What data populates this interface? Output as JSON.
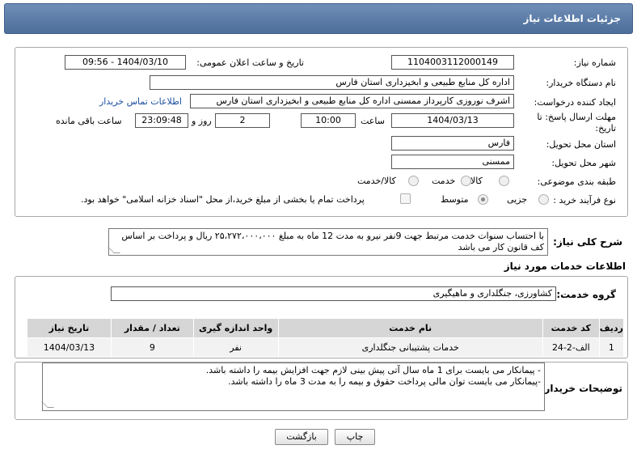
{
  "header": {
    "title": "جزئیات اطلاعات نیاز"
  },
  "form": {
    "need_number_label": "شماره نیاز:",
    "need_number": "1104003112000149",
    "announce_label": "تاریخ و ساعت اعلان عمومی:",
    "announce_value": "1404/03/10 - 09:56",
    "buyer_label": "نام دستگاه خریدار:",
    "buyer_value": "اداره کل منابع طبیعی و ابخیزداری استان فارس",
    "creator_label": "ایجاد کننده درخواست:",
    "creator_value": "اشرف نوروزی کارپرداز ممسنی اداره کل منابع طبیعی و ابخیزداری استان فارس",
    "contact_link": "اطلاعات تماس خریدار",
    "deadline_label": "مهلت ارسال پاسخ: تا تاریخ:",
    "deadline_date": "1404/03/13",
    "time_label": "ساعت",
    "deadline_time": "10:00",
    "days_value": "2",
    "days_label": "روز و",
    "remaining_time": "23:09:48",
    "remaining_label": "ساعت باقی مانده",
    "province_label": "استان محل تحویل:",
    "province_value": "فارس",
    "city_label": "شهر محل تحویل:",
    "city_value": "ممسنی",
    "category_label": "طبقه بندی موضوعی:",
    "category_options": [
      "کالا",
      "خدمت",
      "کالا/خدمت"
    ],
    "process_label": "نوع فرآیند خرید :",
    "process_options": [
      "جزیی",
      "متوسط"
    ],
    "payment_note": "پرداخت تمام یا بخشی از مبلغ خرید،از محل \"اسناد خزانه اسلامی\" خواهد بود."
  },
  "summary": {
    "label": "شرح کلی نیاز:",
    "text": "با احتساب سنوات خدمت مرتبط جهت  9نفر نیرو به مدت 12 ماه به مبلغ ۲۵،۲۷۲،۰۰۰،۰۰۰ ریال و پرداخت بر اساس کف قانون کار می باشد"
  },
  "services": {
    "section_title": "اطلاعات خدمات مورد نیاز",
    "group_label": "گروه خدمت:",
    "group_value": "کشاورزی، جنگلداری و ماهیگیری",
    "columns": [
      "ردیف",
      "کد خدمت",
      "نام خدمت",
      "واحد اندازه گیری",
      "تعداد / مقدار",
      "تاریخ نیاز"
    ],
    "rows": [
      [
        "1",
        "الف-2-24",
        "خدمات پشتیبانی جنگلداری",
        "نفر",
        "9",
        "1404/03/13"
      ]
    ]
  },
  "notes": {
    "label": "توضیحات خریدار:",
    "lines": [
      "- پیمانکار می بایست برای 1 ماه سال آتی پیش بینی لازم جهت افزایش بیمه را داشته باشد.",
      "-پیمانکار می بایست توان مالی پرداخت حقوق و بیمه را به مدت 3 ماه را داشته باشد."
    ]
  },
  "buttons": {
    "print": "چاپ",
    "back": "بازگشت"
  }
}
